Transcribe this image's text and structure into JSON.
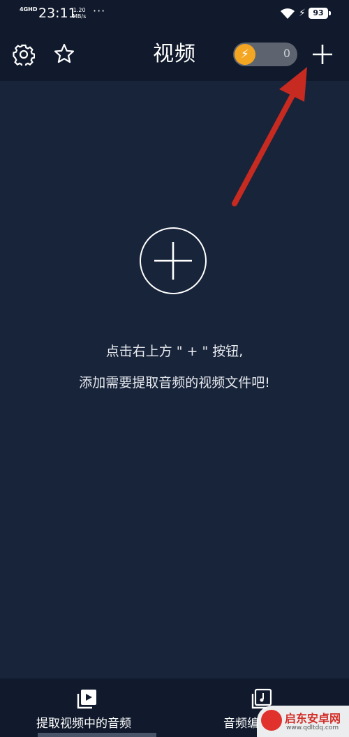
{
  "status_bar": {
    "network": "4GHD",
    "time": "23:11",
    "speed_value": "1.20",
    "speed_unit": "MB/s",
    "more": "···",
    "battery": "93"
  },
  "header": {
    "title": "视频",
    "coin_count": "0",
    "toggle_color": "#f4a623"
  },
  "empty_state": {
    "hint_line1": "点击右上方 \" + \" 按钮,",
    "hint_line2": "添加需要提取音频的视频文件吧!"
  },
  "bottom_nav": {
    "items": [
      {
        "label": "提取视频中的音频",
        "icon": "video-play-icon"
      },
      {
        "label": "音频编",
        "icon": "music-note-icon"
      }
    ]
  },
  "watermark": {
    "name": "启东安卓网",
    "url": "www.qdltdq.com"
  },
  "colors": {
    "background": "#18243a",
    "bar": "#101a2c",
    "annotation_arrow": "#c62a20"
  }
}
